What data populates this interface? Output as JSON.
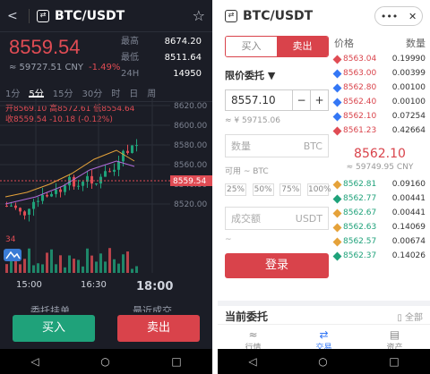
{
  "left": {
    "back": "<",
    "pair": "BTC/USDT",
    "star": "☆",
    "price": "8559.54",
    "cny": "≈ 59727.51 CNY",
    "pct": "-1.49%",
    "stats": [
      {
        "k": "最高",
        "v": "8674.20"
      },
      {
        "k": "最低",
        "v": "8511.64"
      },
      {
        "k": "24H",
        "v": "14950"
      }
    ],
    "tabs": [
      "1分",
      "5分",
      "15分",
      "30分",
      "时",
      "日",
      "周"
    ],
    "active_tab": "5分",
    "ma_line1": {
      "a": "开8569.10",
      "b": "高8572.61",
      "c": "低8554.64"
    },
    "ma_line2": {
      "a": "收8559.54",
      "b": "-10.18",
      "c": "(-0.12%)"
    },
    "yticks": [
      "8620.00",
      "8600.00",
      "8580.00",
      "8560.00",
      "8540.00",
      "8520.00"
    ],
    "price_tag": "8559.54",
    "vol_label": "34",
    "xlabels": [
      "15:00",
      "16:30",
      "18:00"
    ],
    "bottom_tabs": [
      "委托挂单",
      "最近成交"
    ],
    "buy": "买入",
    "sell": "卖出"
  },
  "right": {
    "pair": "BTC/USDT",
    "change": "-1.49%",
    "menu_dots": "•••",
    "close": "✕",
    "buy_tab": "买入",
    "sell_tab": "卖出",
    "order_type": "限价委托 ▼",
    "price_value": "8557.10",
    "minus": "−",
    "plus": "+",
    "cny_est": "≈ ¥ 59715.06",
    "qty_placeholder": "数量",
    "qty_unit": "BTC",
    "available": "可用 ~ BTC",
    "pcts": [
      "25%",
      "50%",
      "75%",
      "100%"
    ],
    "amount_placeholder": "成交额",
    "amount_unit": "USDT",
    "tilde": "~",
    "login": "登录",
    "ob_price_header": "价格",
    "ob_qty_header": "数量",
    "asks": [
      {
        "p": "8563.04",
        "q": "0.19990",
        "color": "#e04c54"
      },
      {
        "p": "8563.00",
        "q": "0.00399",
        "color": "#3477f5"
      },
      {
        "p": "8562.80",
        "q": "0.00100",
        "color": "#3477f5"
      },
      {
        "p": "8562.40",
        "q": "0.00100",
        "color": "#3477f5"
      },
      {
        "p": "8562.10",
        "q": "0.07254",
        "color": "#3477f5"
      },
      {
        "p": "8561.23",
        "q": "0.42664",
        "color": "#e04c54"
      }
    ],
    "mid_price": "8562.10",
    "mid_cny": "≈ 59749.95 CNY",
    "bids": [
      {
        "p": "8562.81",
        "q": "0.09160",
        "color": "#e5a23a"
      },
      {
        "p": "8562.77",
        "q": "0.00441",
        "color": "#1fa27a"
      },
      {
        "p": "8562.67",
        "q": "0.00441",
        "color": "#e5a23a"
      },
      {
        "p": "8562.63",
        "q": "0.14069",
        "color": "#e5a23a"
      },
      {
        "p": "8562.57",
        "q": "0.00674",
        "color": "#e5a23a"
      },
      {
        "p": "8562.37",
        "q": "0.14026",
        "color": "#1fa27a"
      }
    ],
    "current_orders": "当前委托",
    "all": "全部",
    "tabbar": [
      {
        "icon": "≈",
        "label": "行情"
      },
      {
        "icon": "⇄",
        "label": "交易"
      },
      {
        "icon": "▤",
        "label": "资产"
      }
    ]
  },
  "nav": {
    "back": "◁",
    "home": "○",
    "recent": "□"
  }
}
